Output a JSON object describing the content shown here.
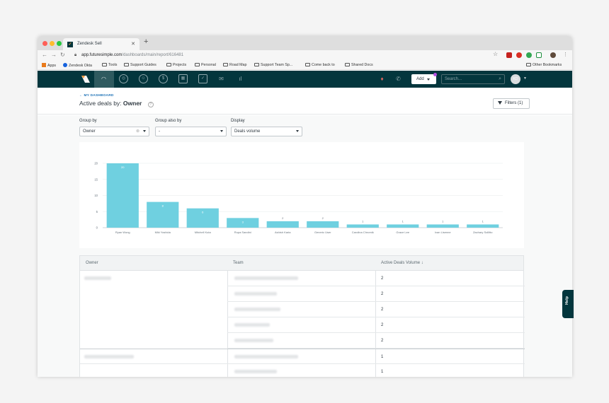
{
  "browser": {
    "tab_title": "Zendesk Sell",
    "url_host": "app.futuresimple.com",
    "url_path": "/dashboards/main/report/616481",
    "bookmarks": [
      "Apps",
      "Zendesk Okta",
      "Tools",
      "Support Guides",
      "Projects",
      "Personal",
      "Road Map",
      "Support Team Sp...",
      "Come back to",
      "Shared Docs"
    ],
    "other_bookmarks": "Other Bookmarks"
  },
  "appnav": {
    "add_label": "Add",
    "search_placeholder": "Search...",
    "avatar_initials": "KD"
  },
  "page": {
    "back_label": "MY DASHBOARD",
    "title_prefix": "Active deals by:",
    "title_owner": "Owner",
    "filters_label": "Filters (1)"
  },
  "controls": {
    "group_by_label": "Group by",
    "group_by_value": "Owner",
    "group_also_label": "Group also by",
    "group_also_value": "-",
    "display_label": "Display",
    "display_value": "Deals volume"
  },
  "chart_data": {
    "type": "bar",
    "categories": [
      "Ryan Wong",
      "Miki Yoshida",
      "Mitchell Kuta",
      "Rupa Sandini",
      "Ashish Karia",
      "Generic User",
      "Carolina Chromik",
      "Grace Lee",
      "Ivan Lisenne",
      "Zachary Sollitto"
    ],
    "values": [
      20,
      8,
      6,
      3,
      2,
      2,
      1,
      1,
      1,
      1
    ],
    "ylim": [
      0,
      20
    ],
    "yticks": [
      0,
      5,
      10,
      15,
      20
    ],
    "grid": true,
    "color": "#6fd0e0"
  },
  "table": {
    "headers": [
      "Owner",
      "Team",
      "Active Deals Volume ↓"
    ],
    "values": [
      "2",
      "2",
      "2",
      "2",
      "2",
      "1",
      "1"
    ]
  },
  "help_label": "Help"
}
